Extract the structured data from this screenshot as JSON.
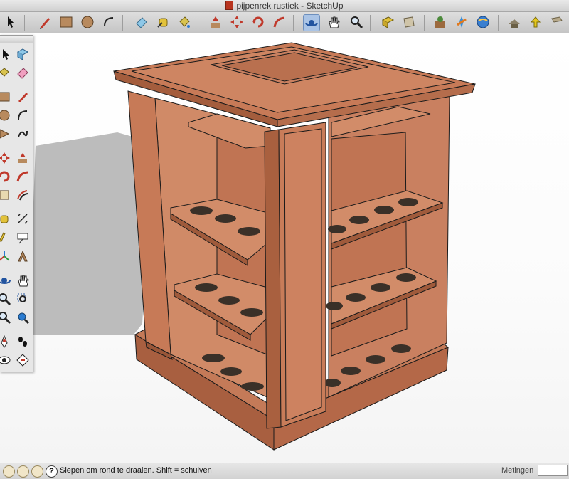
{
  "window": {
    "title": "pijpenrek rustiek - SketchUp"
  },
  "toolbar": {
    "items": [
      "select-icon",
      "pencil-icon",
      "rectangle-icon",
      "circle-icon",
      "arc-icon",
      "eraser-icon",
      "tape-measure-icon",
      "paint-bucket-icon",
      "push-pull-icon",
      "move-icon",
      "rotate-icon",
      "follow-me-icon",
      "orbit-icon",
      "pan-icon",
      "zoom-icon",
      "zoom-extents-icon",
      "section-icon",
      "add-location-icon",
      "components-icon",
      "warehouse-icon",
      "share-model-icon",
      "get-models-icon",
      "extension-icon"
    ]
  },
  "palette": {
    "tools": [
      "select-icon",
      "component-icon",
      "paint-bucket-icon",
      "eraser-icon",
      "rectangle-icon",
      "line-icon",
      "circle-icon",
      "arc-icon",
      "polygon-icon",
      "freehand-icon",
      "move-icon",
      "push-pull-icon",
      "rotate-icon",
      "follow-me-icon",
      "scale-icon",
      "offset-icon",
      "tape-measure-icon",
      "dimension-icon",
      "protractor-icon",
      "text-icon",
      "axes-icon",
      "3d-text-icon",
      "orbit-icon",
      "pan-icon",
      "zoom-icon",
      "zoom-window-icon",
      "zoom-extents-icon",
      "previous-icon",
      "position-camera-icon",
      "walk-icon",
      "look-around-icon",
      "section-plane-icon"
    ]
  },
  "status": {
    "text": "Slepen om rond te draaien. Shift = schuiven",
    "measurements_label": "Metingen",
    "measurements_value": ""
  },
  "colors": {
    "wood": "#c77a57",
    "wood_dark": "#a45d3d",
    "wood_light": "#d68c68",
    "hole": "#3a3028",
    "shadow": "#bdbdbd"
  }
}
